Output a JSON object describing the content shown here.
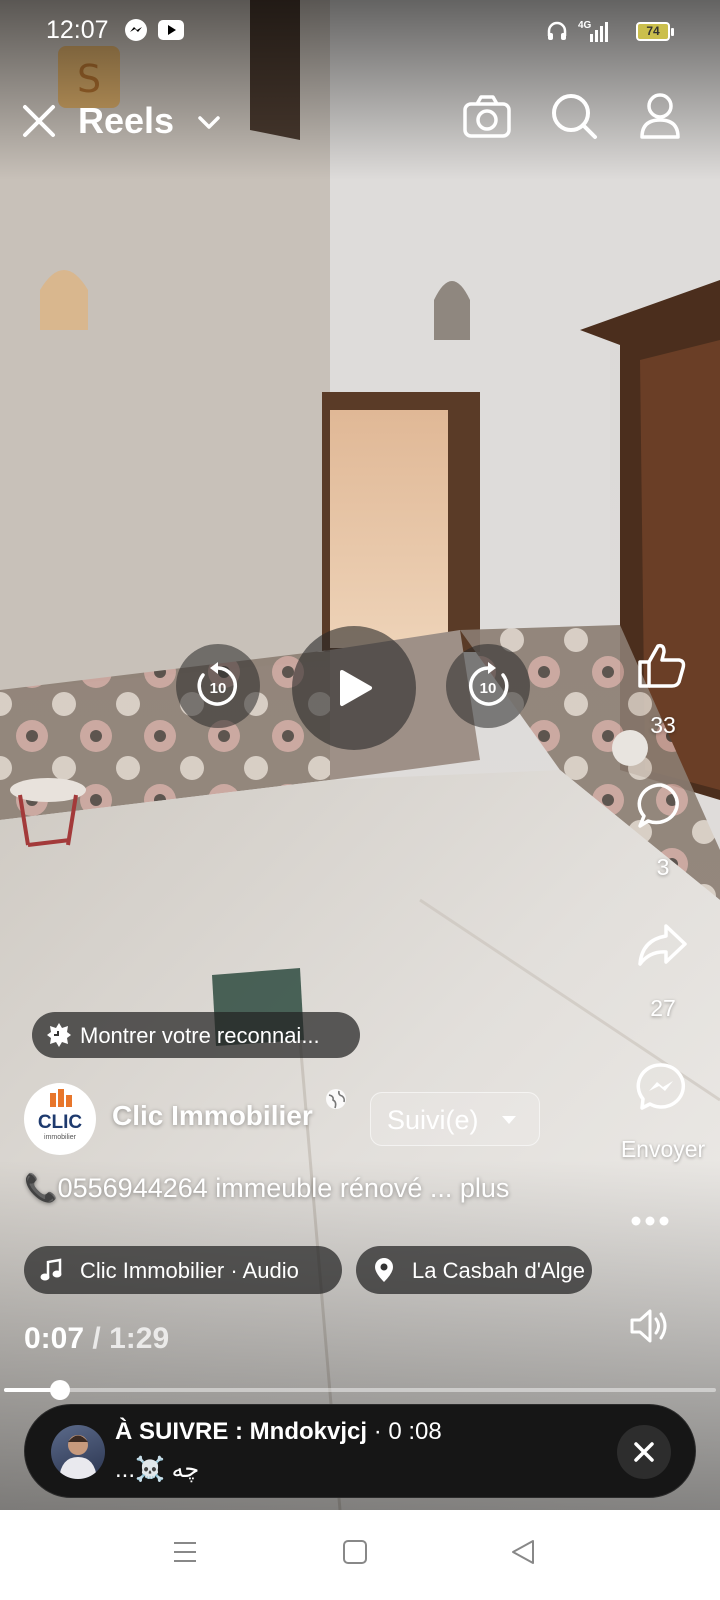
{
  "status_bar": {
    "time": "12:07",
    "icons": [
      "messenger-icon",
      "youtube-icon",
      "headphones-icon",
      "signal-4g-icon"
    ],
    "network": "4G",
    "battery": "74"
  },
  "header": {
    "title": "Reels",
    "icons": [
      "close-icon",
      "chevron-down-icon",
      "camera-icon",
      "search-icon",
      "profile-icon"
    ]
  },
  "controls": {
    "rewind_seconds": "10",
    "forward_seconds": "10",
    "icons": [
      "rewind-10-icon",
      "play-icon",
      "forward-10-icon"
    ]
  },
  "actions": {
    "likes": "33",
    "comments": "3",
    "shares": "27",
    "send_label": "Envoyer",
    "icons": [
      "like-icon",
      "comment-icon",
      "share-icon",
      "messenger-icon",
      "more-icon"
    ]
  },
  "appreciation": {
    "label": "Montrer votre reconnai..."
  },
  "author": {
    "name": "Clic Immobilier",
    "avatar_text": "CLIC",
    "avatar_subtext": "immobilier",
    "follow_label": "Suivi(e)"
  },
  "caption": {
    "text": "📞0556944264 immeuble rénové ... plus"
  },
  "chips": {
    "audio": "Clic Immobilier · Audio",
    "location": "La Casbah d'Alge"
  },
  "playback": {
    "current": "0:07",
    "separator": "/",
    "duration": "1:29",
    "progress_fraction": 0.078
  },
  "up_next": {
    "prefix": "À SUIVRE : Mndokvjcj",
    "time": " · 0 :08",
    "subtitle": "...☠️ چه"
  },
  "colors": {
    "battery": "#cbbf4d",
    "card": "#161616",
    "chip": "#232323"
  }
}
